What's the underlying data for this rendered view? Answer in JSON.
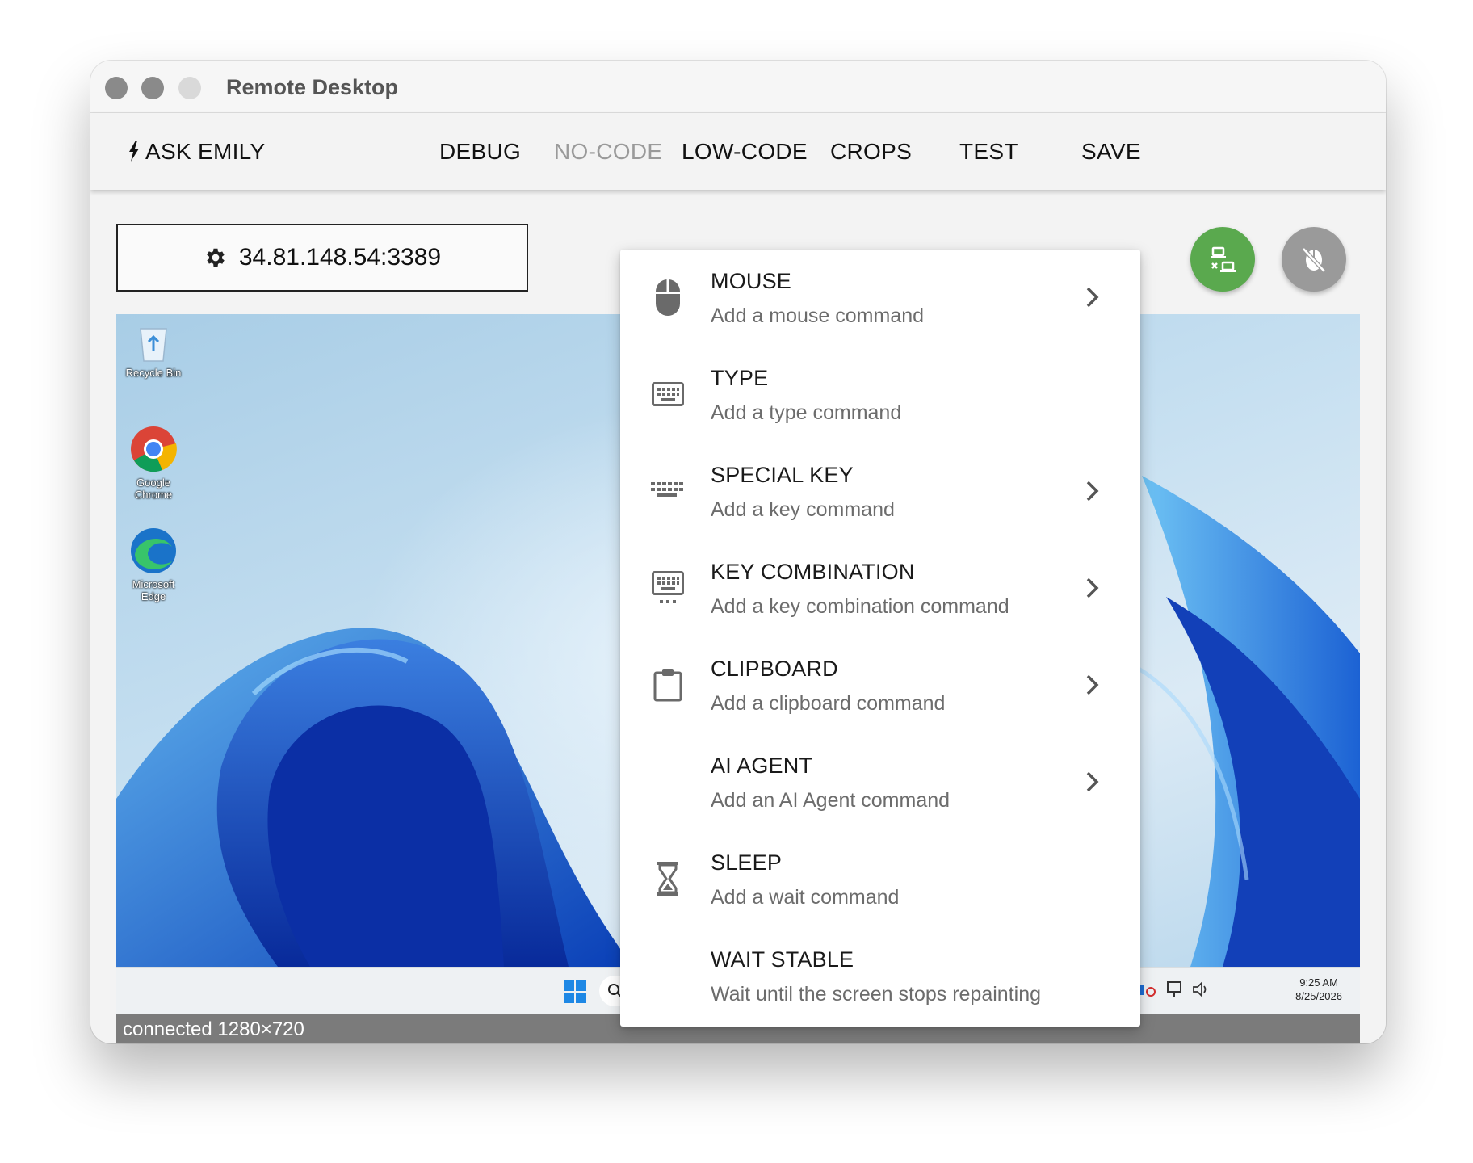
{
  "window": {
    "title": "Remote Desktop"
  },
  "toolbar": {
    "ask_label": "ASK EMILY",
    "items": [
      {
        "label": "DEBUG",
        "enabled": true
      },
      {
        "label": "NO-CODE",
        "enabled": false
      },
      {
        "label": "LOW-CODE",
        "enabled": true
      },
      {
        "label": "CROPS",
        "enabled": true
      },
      {
        "label": "TEST",
        "enabled": true
      },
      {
        "label": "SAVE",
        "enabled": true
      }
    ]
  },
  "connection": {
    "host": "34.81.148.54:3389",
    "status": "connected 1280×720"
  },
  "desktop": {
    "icons": [
      {
        "label_line1": "Recycle Bin",
        "label_line2": ""
      },
      {
        "label_line1": "Google",
        "label_line2": "Chrome"
      },
      {
        "label_line1": "Microsoft",
        "label_line2": "Edge"
      }
    ],
    "clock": {
      "time": "9:25 AM",
      "date": "8/25/2026"
    }
  },
  "menu": {
    "items": [
      {
        "title": "MOUSE",
        "subtitle": "Add a mouse command",
        "icon": "mouse-icon",
        "submenu": true
      },
      {
        "title": "TYPE",
        "subtitle": "Add a type command",
        "icon": "keyboard-icon",
        "submenu": false
      },
      {
        "title": "SPECIAL KEY",
        "subtitle": "Add a key command",
        "icon": "keyboard-alt-icon",
        "submenu": true
      },
      {
        "title": "KEY COMBINATION",
        "subtitle": "Add a key combination command",
        "icon": "keyboard-command-icon",
        "submenu": true
      },
      {
        "title": "CLIPBOARD",
        "subtitle": "Add a clipboard command",
        "icon": "clipboard-icon",
        "submenu": true
      },
      {
        "title": "AI AGENT",
        "subtitle": "Add an AI Agent command",
        "icon": "",
        "submenu": true
      },
      {
        "title": "SLEEP",
        "subtitle": "Add a wait command",
        "icon": "hourglass-icon",
        "submenu": false
      },
      {
        "title": "WAIT STABLE",
        "subtitle": "Wait until the screen stops repainting",
        "icon": "",
        "submenu": false
      }
    ]
  },
  "colors": {
    "accent_green": "#5aa94e",
    "fab_grey": "#9a9a9a",
    "status_bar": "#7b7b7b"
  }
}
